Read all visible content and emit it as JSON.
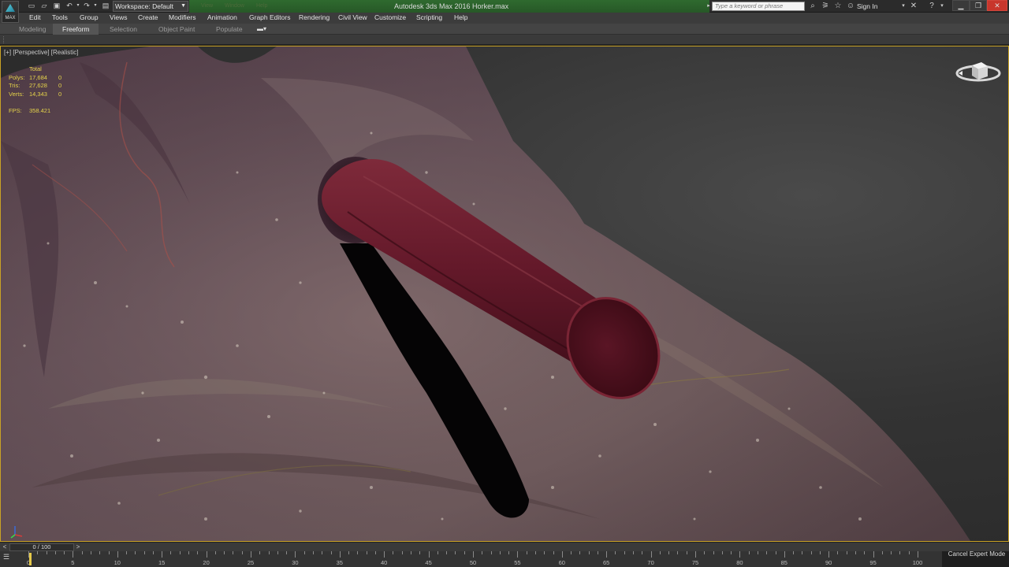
{
  "titlebar": {
    "app_title": "Autodesk 3ds Max 2016     Horker.max",
    "logo_text": "MAX",
    "workspace": "Workspace: Default",
    "ghost_menus": [
      "View",
      "Window",
      "Help"
    ],
    "search_placeholder": "Type a keyword or phrase",
    "sign_in": "Sign In"
  },
  "menu": {
    "items": [
      "Edit",
      "Tools",
      "Group",
      "Views",
      "Create",
      "Modifiers",
      "Animation",
      "Graph Editors",
      "Rendering",
      "Civil View",
      "Customize",
      "Scripting",
      "Help"
    ]
  },
  "ribbon": {
    "tabs": [
      "Modeling",
      "Freeform",
      "Selection",
      "Object Paint",
      "Populate"
    ],
    "active_tab": "Freeform"
  },
  "viewport": {
    "label": "[+] [Perspective] [Realistic]",
    "stats": {
      "header": "Total",
      "rows": [
        {
          "key": "Polys:",
          "value": "17,684",
          "sel": "0"
        },
        {
          "key": "Tris:",
          "value": "27,628",
          "sel": "0"
        },
        {
          "key": "Verts:",
          "value": "14,343",
          "sel": "0"
        }
      ],
      "fps_key": "FPS:",
      "fps_value": "358.421"
    },
    "colors": {
      "border_active": "#c9a225",
      "stats_text": "#e4d24a",
      "surface": "#6e5560",
      "tube": "#6a1f2c"
    }
  },
  "timeslider": {
    "frame_display": "0 / 100",
    "prev_icon": "chevron-left-icon",
    "next_icon": "chevron-right-icon"
  },
  "trackbar": {
    "labels": [
      "0",
      "5",
      "10",
      "15",
      "20",
      "25",
      "30",
      "35",
      "40",
      "45",
      "50",
      "55",
      "60",
      "65",
      "70",
      "75",
      "80",
      "85",
      "90",
      "95",
      "100"
    ]
  },
  "status": {
    "expert_mode": "Cancel Expert Mode"
  }
}
